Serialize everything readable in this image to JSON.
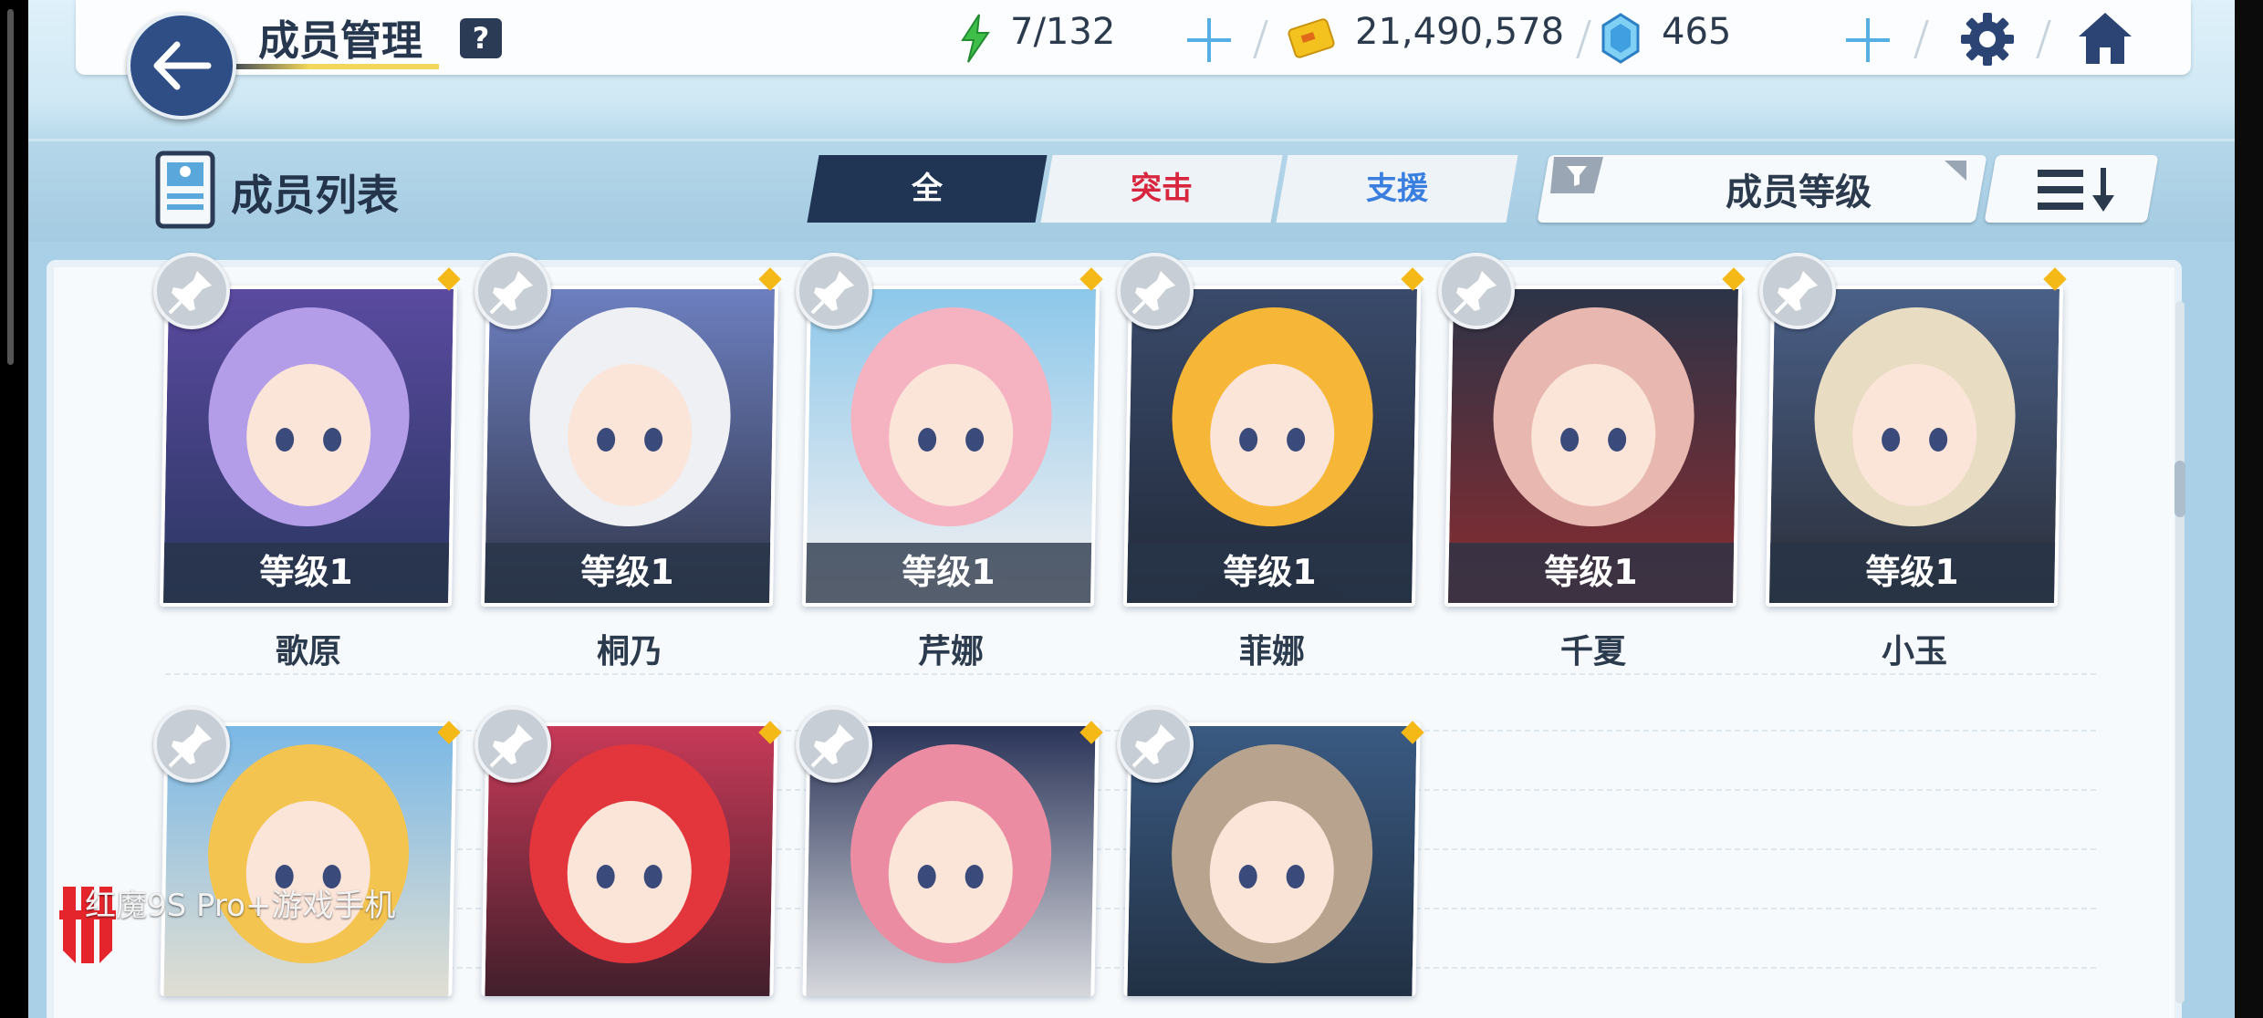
{
  "header": {
    "title": "成员管理",
    "help_label": "?",
    "stamina": "7/132",
    "credits": "21,490,578",
    "gems": "465"
  },
  "section": {
    "title": "成员列表",
    "tabs": [
      {
        "label": "全",
        "active": true,
        "color": "#ffffff"
      },
      {
        "label": "突击",
        "active": false,
        "color": "#d7263d"
      },
      {
        "label": "支援",
        "active": false,
        "color": "#3a7ee0"
      }
    ],
    "sort_label": "成员等级"
  },
  "members": [
    {
      "name": "歌原",
      "level": "等级1",
      "palette": [
        "#5a4aa0",
        "#b39ce8",
        "#2a3660"
      ]
    },
    {
      "name": "桐乃",
      "level": "等级1",
      "palette": [
        "#6d7fc0",
        "#eef0f4",
        "#31364a"
      ]
    },
    {
      "name": "芹娜",
      "level": "等级1",
      "palette": [
        "#8cc7ea",
        "#f5b2c0",
        "#f6f2f2"
      ]
    },
    {
      "name": "菲娜",
      "level": "等级1",
      "palette": [
        "#3a4a6a",
        "#f6b637",
        "#222a3a"
      ]
    },
    {
      "name": "千夏",
      "level": "等级1",
      "palette": [
        "#2c3448",
        "#e8b8b0",
        "#8a2b2f"
      ]
    },
    {
      "name": "小玉",
      "level": "等级1",
      "palette": [
        "#4a6088",
        "#e8dcc2",
        "#2a2e38"
      ]
    },
    {
      "name": "",
      "level": "",
      "palette": [
        "#7ab8e6",
        "#f4c451",
        "#f1e4cf"
      ]
    },
    {
      "name": "",
      "level": "",
      "palette": [
        "#c83a58",
        "#e2363c",
        "#2b1a24"
      ]
    },
    {
      "name": "",
      "level": "",
      "palette": [
        "#2a3458",
        "#ec8ca2",
        "#f2f2f2"
      ]
    },
    {
      "name": "",
      "level": "",
      "palette": [
        "#3a5a82",
        "#b8a48e",
        "#1e2a3a"
      ]
    }
  ],
  "watermark": "红魔9S Pro+游戏手机"
}
